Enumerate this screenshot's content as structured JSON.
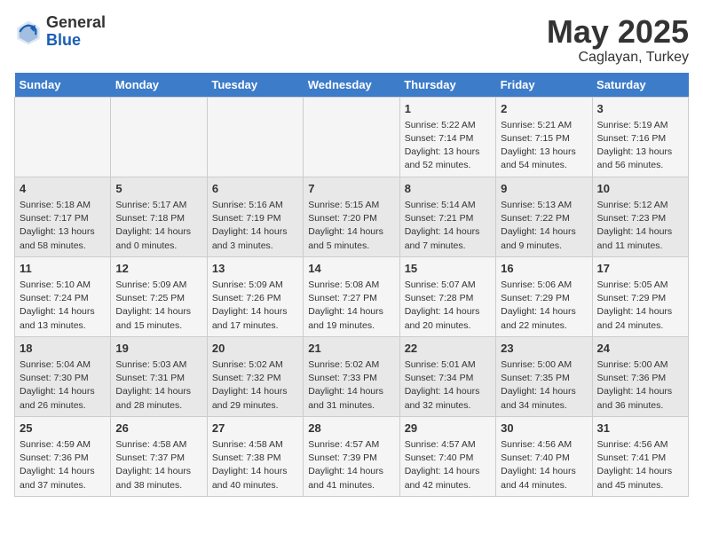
{
  "header": {
    "logo_line1": "General",
    "logo_line2": "Blue",
    "month": "May 2025",
    "location": "Caglayan, Turkey"
  },
  "weekdays": [
    "Sunday",
    "Monday",
    "Tuesday",
    "Wednesday",
    "Thursday",
    "Friday",
    "Saturday"
  ],
  "weeks": [
    [
      {
        "day": "",
        "info": ""
      },
      {
        "day": "",
        "info": ""
      },
      {
        "day": "",
        "info": ""
      },
      {
        "day": "",
        "info": ""
      },
      {
        "day": "1",
        "info": "Sunrise: 5:22 AM\nSunset: 7:14 PM\nDaylight: 13 hours\nand 52 minutes."
      },
      {
        "day": "2",
        "info": "Sunrise: 5:21 AM\nSunset: 7:15 PM\nDaylight: 13 hours\nand 54 minutes."
      },
      {
        "day": "3",
        "info": "Sunrise: 5:19 AM\nSunset: 7:16 PM\nDaylight: 13 hours\nand 56 minutes."
      }
    ],
    [
      {
        "day": "4",
        "info": "Sunrise: 5:18 AM\nSunset: 7:17 PM\nDaylight: 13 hours\nand 58 minutes."
      },
      {
        "day": "5",
        "info": "Sunrise: 5:17 AM\nSunset: 7:18 PM\nDaylight: 14 hours\nand 0 minutes."
      },
      {
        "day": "6",
        "info": "Sunrise: 5:16 AM\nSunset: 7:19 PM\nDaylight: 14 hours\nand 3 minutes."
      },
      {
        "day": "7",
        "info": "Sunrise: 5:15 AM\nSunset: 7:20 PM\nDaylight: 14 hours\nand 5 minutes."
      },
      {
        "day": "8",
        "info": "Sunrise: 5:14 AM\nSunset: 7:21 PM\nDaylight: 14 hours\nand 7 minutes."
      },
      {
        "day": "9",
        "info": "Sunrise: 5:13 AM\nSunset: 7:22 PM\nDaylight: 14 hours\nand 9 minutes."
      },
      {
        "day": "10",
        "info": "Sunrise: 5:12 AM\nSunset: 7:23 PM\nDaylight: 14 hours\nand 11 minutes."
      }
    ],
    [
      {
        "day": "11",
        "info": "Sunrise: 5:10 AM\nSunset: 7:24 PM\nDaylight: 14 hours\nand 13 minutes."
      },
      {
        "day": "12",
        "info": "Sunrise: 5:09 AM\nSunset: 7:25 PM\nDaylight: 14 hours\nand 15 minutes."
      },
      {
        "day": "13",
        "info": "Sunrise: 5:09 AM\nSunset: 7:26 PM\nDaylight: 14 hours\nand 17 minutes."
      },
      {
        "day": "14",
        "info": "Sunrise: 5:08 AM\nSunset: 7:27 PM\nDaylight: 14 hours\nand 19 minutes."
      },
      {
        "day": "15",
        "info": "Sunrise: 5:07 AM\nSunset: 7:28 PM\nDaylight: 14 hours\nand 20 minutes."
      },
      {
        "day": "16",
        "info": "Sunrise: 5:06 AM\nSunset: 7:29 PM\nDaylight: 14 hours\nand 22 minutes."
      },
      {
        "day": "17",
        "info": "Sunrise: 5:05 AM\nSunset: 7:29 PM\nDaylight: 14 hours\nand 24 minutes."
      }
    ],
    [
      {
        "day": "18",
        "info": "Sunrise: 5:04 AM\nSunset: 7:30 PM\nDaylight: 14 hours\nand 26 minutes."
      },
      {
        "day": "19",
        "info": "Sunrise: 5:03 AM\nSunset: 7:31 PM\nDaylight: 14 hours\nand 28 minutes."
      },
      {
        "day": "20",
        "info": "Sunrise: 5:02 AM\nSunset: 7:32 PM\nDaylight: 14 hours\nand 29 minutes."
      },
      {
        "day": "21",
        "info": "Sunrise: 5:02 AM\nSunset: 7:33 PM\nDaylight: 14 hours\nand 31 minutes."
      },
      {
        "day": "22",
        "info": "Sunrise: 5:01 AM\nSunset: 7:34 PM\nDaylight: 14 hours\nand 32 minutes."
      },
      {
        "day": "23",
        "info": "Sunrise: 5:00 AM\nSunset: 7:35 PM\nDaylight: 14 hours\nand 34 minutes."
      },
      {
        "day": "24",
        "info": "Sunrise: 5:00 AM\nSunset: 7:36 PM\nDaylight: 14 hours\nand 36 minutes."
      }
    ],
    [
      {
        "day": "25",
        "info": "Sunrise: 4:59 AM\nSunset: 7:36 PM\nDaylight: 14 hours\nand 37 minutes."
      },
      {
        "day": "26",
        "info": "Sunrise: 4:58 AM\nSunset: 7:37 PM\nDaylight: 14 hours\nand 38 minutes."
      },
      {
        "day": "27",
        "info": "Sunrise: 4:58 AM\nSunset: 7:38 PM\nDaylight: 14 hours\nand 40 minutes."
      },
      {
        "day": "28",
        "info": "Sunrise: 4:57 AM\nSunset: 7:39 PM\nDaylight: 14 hours\nand 41 minutes."
      },
      {
        "day": "29",
        "info": "Sunrise: 4:57 AM\nSunset: 7:40 PM\nDaylight: 14 hours\nand 42 minutes."
      },
      {
        "day": "30",
        "info": "Sunrise: 4:56 AM\nSunset: 7:40 PM\nDaylight: 14 hours\nand 44 minutes."
      },
      {
        "day": "31",
        "info": "Sunrise: 4:56 AM\nSunset: 7:41 PM\nDaylight: 14 hours\nand 45 minutes."
      }
    ]
  ]
}
